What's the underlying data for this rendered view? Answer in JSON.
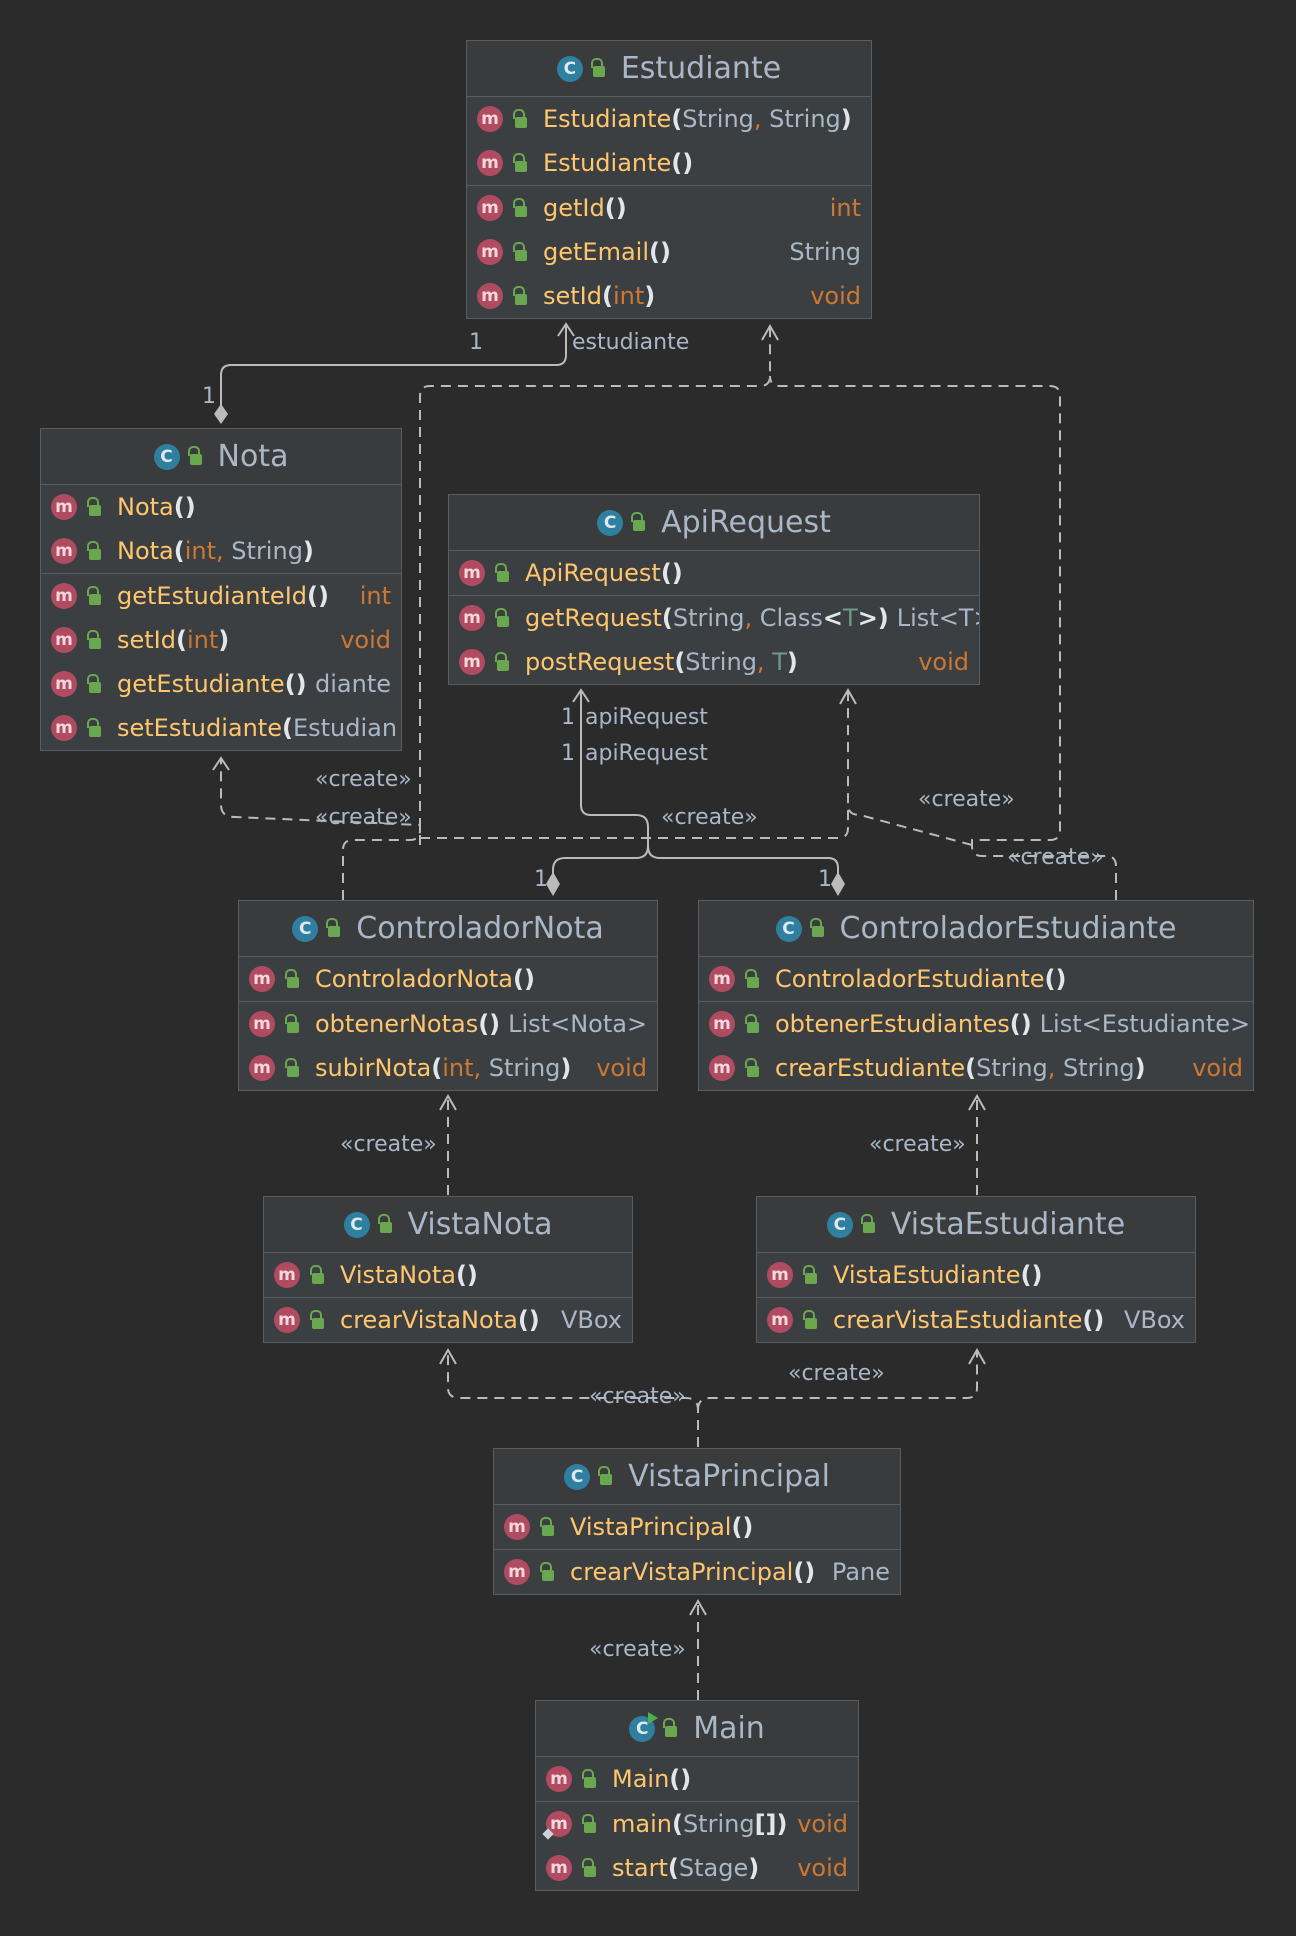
{
  "classes": {
    "estudiante": {
      "name": "Estudiante",
      "sections": [
        [
          {
            "sig": [
              [
                "mn",
                "Estudiante"
              ],
              [
                "br",
                "("
              ],
              [
                "tx",
                "String"
              ],
              [
                "kw",
                ", "
              ],
              [
                "tx",
                "String"
              ],
              [
                "br",
                ")"
              ]
            ],
            "ret": ""
          },
          {
            "sig": [
              [
                "mn",
                "Estudiante"
              ],
              [
                "br",
                "()"
              ]
            ],
            "ret": ""
          }
        ],
        [
          {
            "sig": [
              [
                "mn",
                "getId"
              ],
              [
                "br",
                "()"
              ]
            ],
            "ret": "int",
            "retKw": true
          },
          {
            "sig": [
              [
                "mn",
                "getEmail"
              ],
              [
                "br",
                "()"
              ]
            ],
            "ret": "String",
            "retKw": false
          },
          {
            "sig": [
              [
                "mn",
                "setId"
              ],
              [
                "br",
                "("
              ],
              [
                "kw",
                "int"
              ],
              [
                "br",
                ")"
              ]
            ],
            "ret": "void",
            "retKw": true
          }
        ]
      ]
    },
    "nota": {
      "name": "Nota",
      "sections": [
        [
          {
            "sig": [
              [
                "mn",
                "Nota"
              ],
              [
                "br",
                "()"
              ]
            ],
            "ret": ""
          },
          {
            "sig": [
              [
                "mn",
                "Nota"
              ],
              [
                "br",
                "("
              ],
              [
                "kw",
                "int"
              ],
              [
                "kw",
                ", "
              ],
              [
                "tx",
                "String"
              ],
              [
                "br",
                ")"
              ]
            ],
            "ret": ""
          }
        ],
        [
          {
            "sig": [
              [
                "mn",
                "getEstudianteId"
              ],
              [
                "br",
                "()"
              ]
            ],
            "ret": "int",
            "retKw": true
          },
          {
            "sig": [
              [
                "mn",
                "setId"
              ],
              [
                "br",
                "("
              ],
              [
                "kw",
                "int"
              ],
              [
                "br",
                ")"
              ]
            ],
            "ret": "void",
            "retKw": true
          },
          {
            "sig": [
              [
                "mn",
                "getEstudiante"
              ],
              [
                "br",
                "()"
              ]
            ],
            "ret": "diante",
            "retKw": false
          },
          {
            "sig": [
              [
                "mn",
                "setEstudiante"
              ],
              [
                "br",
                "("
              ],
              [
                "tx",
                "Estudian"
              ]
            ],
            "ret": ""
          }
        ]
      ]
    },
    "apiRequest": {
      "name": "ApiRequest",
      "sections": [
        [
          {
            "sig": [
              [
                "mn",
                "ApiRequest"
              ],
              [
                "br",
                "()"
              ]
            ],
            "ret": ""
          }
        ],
        [
          {
            "sig": [
              [
                "mn",
                "getRequest"
              ],
              [
                "br",
                "("
              ],
              [
                "tx",
                "String"
              ],
              [
                "kw",
                ", "
              ],
              [
                "tx",
                "Class"
              ],
              [
                "br",
                "<"
              ],
              [
                "tp",
                "T"
              ],
              [
                "br",
                ">)"
              ]
            ],
            "ret": "List<T>",
            "retKw": false
          },
          {
            "sig": [
              [
                "mn",
                "postRequest"
              ],
              [
                "br",
                "("
              ],
              [
                "tx",
                "String"
              ],
              [
                "kw",
                ", "
              ],
              [
                "tp",
                "T"
              ],
              [
                "br",
                ")"
              ]
            ],
            "ret": "void",
            "retKw": true
          }
        ]
      ]
    },
    "controladorNota": {
      "name": "ControladorNota",
      "sections": [
        [
          {
            "sig": [
              [
                "mn",
                "ControladorNota"
              ],
              [
                "br",
                "()"
              ]
            ],
            "ret": ""
          }
        ],
        [
          {
            "sig": [
              [
                "mn",
                "obtenerNotas"
              ],
              [
                "br",
                "()"
              ]
            ],
            "ret": "List<Nota>",
            "retKw": false
          },
          {
            "sig": [
              [
                "mn",
                "subirNota"
              ],
              [
                "br",
                "("
              ],
              [
                "kw",
                "int"
              ],
              [
                "kw",
                ", "
              ],
              [
                "tx",
                "String"
              ],
              [
                "br",
                ")"
              ]
            ],
            "ret": "void",
            "retKw": true
          }
        ]
      ]
    },
    "controladorEstudiante": {
      "name": "ControladorEstudiante",
      "sections": [
        [
          {
            "sig": [
              [
                "mn",
                "ControladorEstudiante"
              ],
              [
                "br",
                "()"
              ]
            ],
            "ret": ""
          }
        ],
        [
          {
            "sig": [
              [
                "mn",
                "obtenerEstudiantes"
              ],
              [
                "br",
                "()"
              ]
            ],
            "ret": "List<Estudiante>",
            "retKw": false
          },
          {
            "sig": [
              [
                "mn",
                "crearEstudiante"
              ],
              [
                "br",
                "("
              ],
              [
                "tx",
                "String"
              ],
              [
                "kw",
                ", "
              ],
              [
                "tx",
                "String"
              ],
              [
                "br",
                ")"
              ]
            ],
            "ret": "void",
            "retKw": true
          }
        ]
      ]
    },
    "vistaNota": {
      "name": "VistaNota",
      "sections": [
        [
          {
            "sig": [
              [
                "mn",
                "VistaNota"
              ],
              [
                "br",
                "()"
              ]
            ],
            "ret": ""
          }
        ],
        [
          {
            "sig": [
              [
                "mn",
                "crearVistaNota"
              ],
              [
                "br",
                "()"
              ]
            ],
            "ret": "VBox",
            "retKw": false
          }
        ]
      ]
    },
    "vistaEstudiante": {
      "name": "VistaEstudiante",
      "sections": [
        [
          {
            "sig": [
              [
                "mn",
                "VistaEstudiante"
              ],
              [
                "br",
                "()"
              ]
            ],
            "ret": ""
          }
        ],
        [
          {
            "sig": [
              [
                "mn",
                "crearVistaEstudiante"
              ],
              [
                "br",
                "()"
              ]
            ],
            "ret": "VBox",
            "retKw": false
          }
        ]
      ]
    },
    "vistaPrincipal": {
      "name": "VistaPrincipal",
      "sections": [
        [
          {
            "sig": [
              [
                "mn",
                "VistaPrincipal"
              ],
              [
                "br",
                "()"
              ]
            ],
            "ret": ""
          }
        ],
        [
          {
            "sig": [
              [
                "mn",
                "crearVistaPrincipal"
              ],
              [
                "br",
                "()"
              ]
            ],
            "ret": "Pane",
            "retKw": false
          }
        ]
      ]
    },
    "main": {
      "name": "Main",
      "runnable": true,
      "sections": [
        [
          {
            "sig": [
              [
                "mn",
                "Main"
              ],
              [
                "br",
                "()"
              ]
            ],
            "ret": ""
          }
        ],
        [
          {
            "sig": [
              [
                "mn",
                "main"
              ],
              [
                "br",
                "("
              ],
              [
                "tx",
                "String"
              ],
              [
                "br",
                "[])"
              ]
            ],
            "ret": "void",
            "retKw": true,
            "static": true
          },
          {
            "sig": [
              [
                "mn",
                "start"
              ],
              [
                "br",
                "("
              ],
              [
                "tx",
                "Stage"
              ],
              [
                "br",
                ")"
              ]
            ],
            "ret": "void",
            "retKw": true
          }
        ]
      ]
    }
  },
  "labels": {
    "mult_est": "1",
    "role_est": "estudiante",
    "mult_nota": "1",
    "mult_api1": "1",
    "role_api1": "apiRequest",
    "mult_api2": "1",
    "role_api2": "apiRequest",
    "create": "«create»",
    "mult_cn": "1",
    "mult_ce": "1"
  },
  "icons": {
    "class": "C",
    "method": "m"
  },
  "colors": {
    "background": "#2b2b2b",
    "classBg": "#3c3f41",
    "methodName": "#ffc66d",
    "keyword": "#cc7832",
    "text": "#a9b7c6"
  }
}
